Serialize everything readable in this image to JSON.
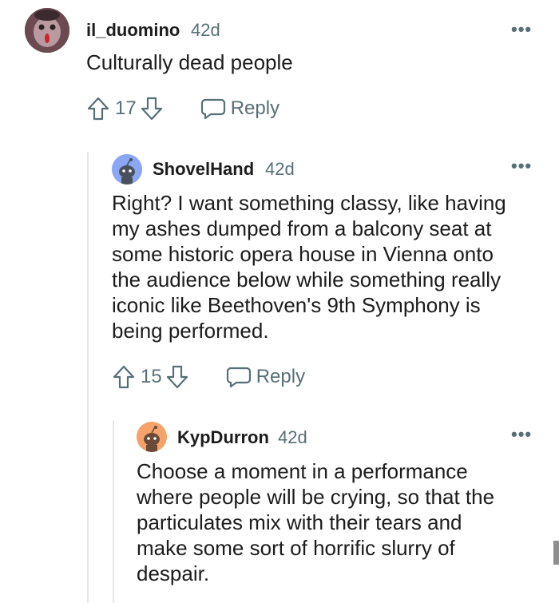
{
  "comments": [
    {
      "username": "il_duomino",
      "time": "42d",
      "text": "Culturally dead people",
      "score": "17",
      "reply_label": "Reply",
      "more_label": "•••",
      "avatar_icon": "user-avatar-photo"
    },
    {
      "username": "ShovelHand",
      "time": "42d",
      "text": "Right? I want something classy, like having\nmy ashes dumped from a balcony seat at\nsome historic opera house in Vienna onto\nthe audience below while something really\niconic like Beethoven's 9th Symphony is\nbeing performed.",
      "score": "15",
      "reply_label": "Reply",
      "more_label": "•••",
      "avatar_icon": "snoo-avatar-blue",
      "avatar_color": "#8aa6f5"
    },
    {
      "username": "KypDurron",
      "time": "42d",
      "text": "Choose a moment in a performance\nwhere people will be crying, so that the\nparticulates mix with their tears and\nmake some sort of horrific slurry of\ndespair.",
      "more_label": "•••",
      "avatar_icon": "snoo-avatar-orange",
      "avatar_color": "#f5a36b"
    }
  ],
  "colors": {
    "text": "#1c1c1c",
    "meta": "#576f76",
    "thread_line": "#e5e5e5"
  }
}
